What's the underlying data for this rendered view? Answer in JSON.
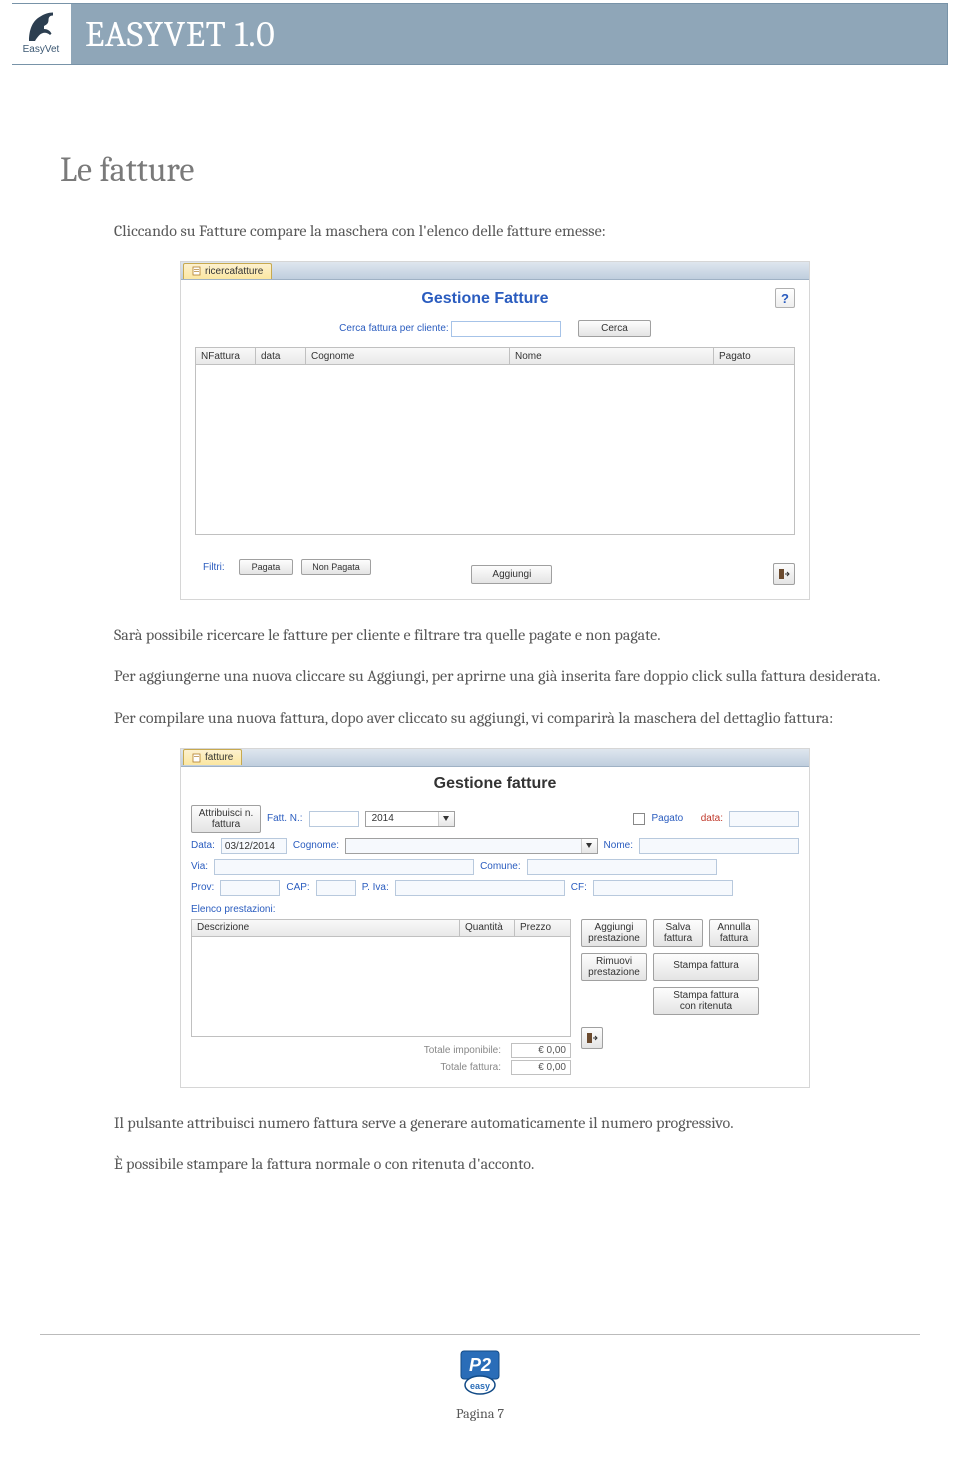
{
  "brand": {
    "logo_label": "EasyVet",
    "banner_title": "EASYVET 1.0"
  },
  "heading": "Le fatture",
  "paragraphs": {
    "p1": "Cliccando su Fatture compare la maschera con l'elenco delle fatture emesse:",
    "p2": "Sarà possibile ricercare le fatture per cliente e filtrare tra quelle pagate e non pagate.",
    "p3": "Per aggiungerne una nuova cliccare su Aggiungi, per aprirne una già inserita fare doppio click sulla fattura desiderata.",
    "p4": "Per compilare una nuova fattura, dopo aver cliccato su aggiungi, vi comparirà la maschera del dettaglio fattura:",
    "p5": "Il pulsante attribuisci numero fattura serve a generare automaticamente il numero progressivo.",
    "p6": "È possibile stampare la fattura normale o con ritenuta d'acconto."
  },
  "mock1": {
    "tab": "ricercafatture",
    "title": "Gestione Fatture",
    "search_label": "Cerca fattura per cliente:",
    "search_btn": "Cerca",
    "columns": [
      "NFattura",
      "data",
      "Cognome",
      "Nome",
      "Pagato"
    ],
    "filtri_label": "Filtri:",
    "btn_pagata": "Pagata",
    "btn_non_pagata": "Non Pagata",
    "btn_aggiungi": "Aggiungi"
  },
  "mock2": {
    "tab": "fatture",
    "title": "Gestione fatture",
    "btn_attribuisci": "Attribuisci n.\nfattura",
    "lbl_fatt_n": "Fatt. N.:",
    "year": "2014",
    "lbl_pagato": "Pagato",
    "lbl_data": "data:",
    "lbl_data2": "Data:",
    "data_val": "03/12/2014",
    "lbl_cognome": "Cognome:",
    "lbl_nome": "Nome:",
    "lbl_via": "Via:",
    "lbl_comune": "Comune:",
    "lbl_prov": "Prov:",
    "lbl_cap": "CAP:",
    "lbl_piva": "P. Iva:",
    "lbl_cf": "CF:",
    "elenco": "Elenco prestazioni:",
    "prest_cols": [
      "Descrizione",
      "Quantità",
      "Prezzo"
    ],
    "btn_agg_prest": "Aggiungi\nprestazione",
    "btn_rim_prest": "Rimuovi\nprestazione",
    "btn_salva": "Salva\nfattura",
    "btn_annulla": "Annulla\nfattura",
    "btn_stampa": "Stampa fattura",
    "btn_stampa_rit": "Stampa fattura\ncon ritenuta",
    "lbl_tot_imp": "Totale imponibile:",
    "lbl_tot_fat": "Totale fattura:",
    "val_zero": "€ 0,00"
  },
  "footer": {
    "page": "Pagina 7"
  }
}
